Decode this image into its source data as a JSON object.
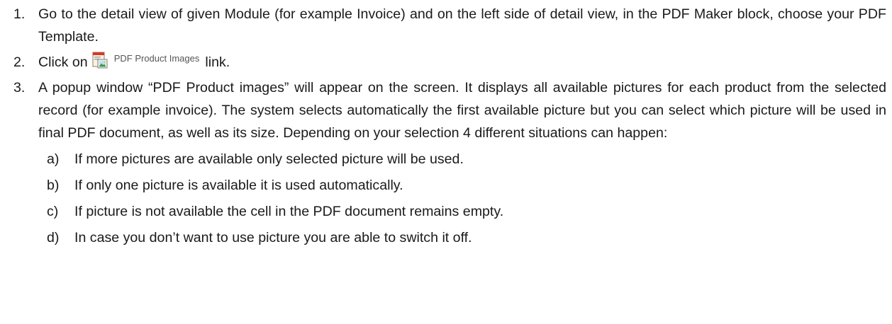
{
  "steps": [
    {
      "number": "1.",
      "text": "Go to the detail view of given Module (for example Invoice) and on the left side of detail view, in the PDF Maker block, choose your PDF Template."
    },
    {
      "number": "2.",
      "text_before": "Click on",
      "link_icon": "pdf-image-icon",
      "link_label": "PDF Product Images",
      "text_after": "link."
    },
    {
      "number": "3.",
      "text": "A popup window “PDF Product images” will appear on the screen. It displays all available pictures for each product from the selected record (for example invoice). The system selects automatically the first available picture but you can select which picture will be used in final PDF document, as well as its size. Depending on your selection 4 different situations can happen:",
      "subitems": [
        {
          "letter": "a)",
          "text": "If more pictures are available only selected picture will be used."
        },
        {
          "letter": "b)",
          "text": "If only one picture is available it is used automatically."
        },
        {
          "letter": "c)",
          "text": "If picture is not available the cell in the PDF document remains empty."
        },
        {
          "letter": "d)",
          "text": "In case you don’t want to use picture you are able to switch it off."
        }
      ]
    }
  ]
}
